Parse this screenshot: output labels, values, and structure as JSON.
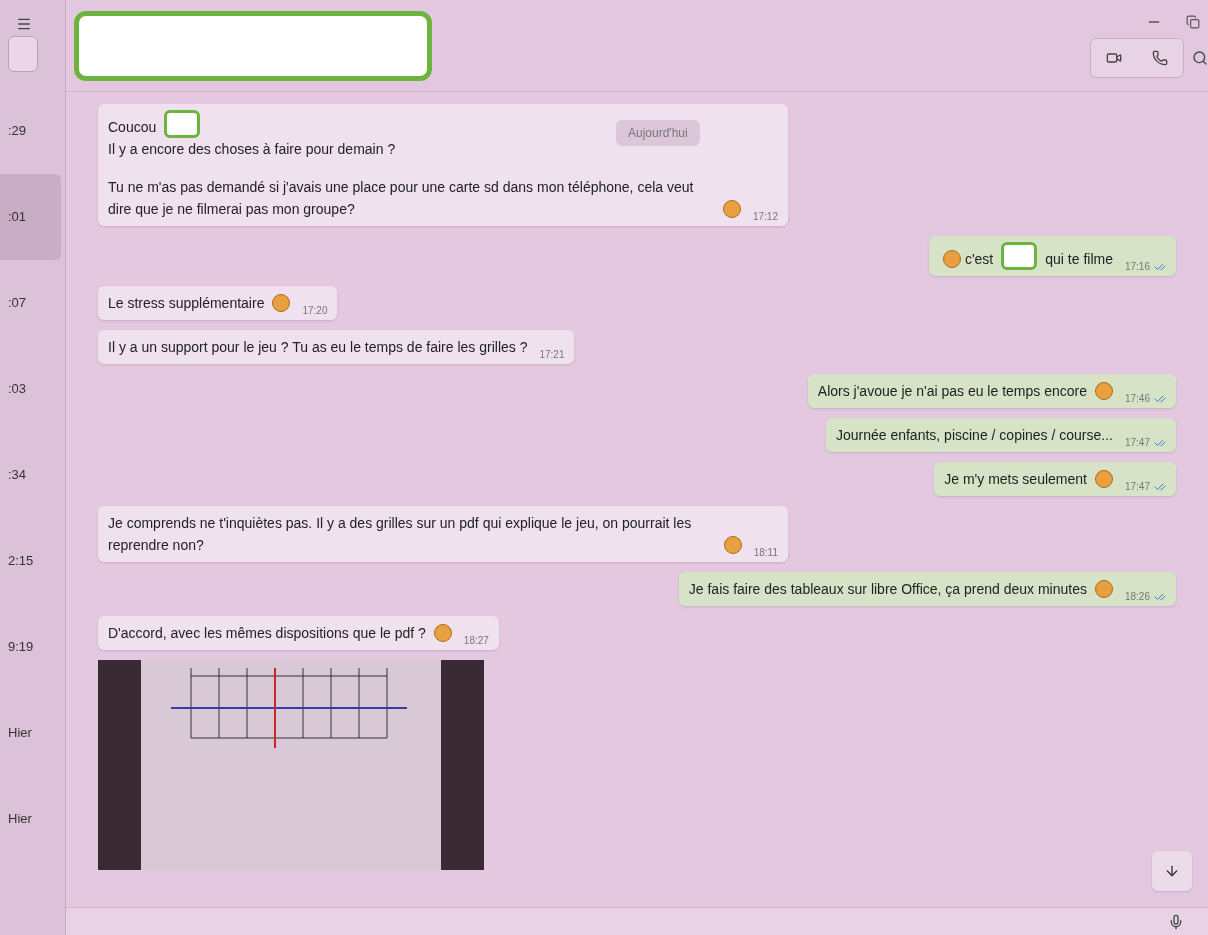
{
  "sidebar": {
    "items": [
      {
        "time": ":29",
        "selected": false
      },
      {
        "time": ":01",
        "selected": true
      },
      {
        "time": ":07",
        "selected": false
      },
      {
        "time": ":03",
        "selected": false
      },
      {
        "time": ":34",
        "selected": false
      },
      {
        "time": "2:15",
        "selected": false
      },
      {
        "time": "9:19",
        "selected": false
      },
      {
        "time": "Hier",
        "selected": false
      },
      {
        "time": "Hier",
        "selected": false
      }
    ]
  },
  "chat": {
    "date_chip": "Aujourd'hui",
    "messages": [
      {
        "kind": "incoming",
        "time": "17:12",
        "paragraphs": [
          [
            [
              {
                "kind": "text",
                "text": "Coucou"
              },
              {
                "kind": "redaction"
              }
            ],
            [
              {
                "kind": "text",
                "text": "Il y a encore des choses à faire pour demain ?"
              }
            ]
          ],
          [
            [
              {
                "kind": "text",
                "text": "Tu ne m'as pas demandé si j'avais une place pour une carte sd dans mon téléphone, cela veut dire que je ne filmerai pas mon groupe?"
              },
              {
                "kind": "emoji"
              }
            ]
          ]
        ]
      },
      {
        "kind": "outgoing",
        "time": "17:16",
        "read": true,
        "paragraphs": [
          [
            [
              {
                "kind": "emoji"
              },
              {
                "kind": "text",
                "text": "c'est"
              },
              {
                "kind": "redaction"
              },
              {
                "kind": "text",
                "text": "qui te filme"
              }
            ]
          ]
        ]
      },
      {
        "kind": "incoming",
        "time": "17:20",
        "paragraphs": [
          [
            [
              {
                "kind": "text",
                "text": "Le stress supplémentaire"
              },
              {
                "kind": "emoji"
              }
            ]
          ]
        ]
      },
      {
        "kind": "incoming",
        "time": "17:21",
        "paragraphs": [
          [
            [
              {
                "kind": "text",
                "text": "Il y a un support pour le jeu ? Tu as eu le temps de faire les grilles ?"
              }
            ]
          ]
        ]
      },
      {
        "kind": "outgoing",
        "time": "17:46",
        "read": true,
        "paragraphs": [
          [
            [
              {
                "kind": "text",
                "text": "Alors j'avoue je n'ai pas eu le temps encore"
              },
              {
                "kind": "emoji"
              }
            ]
          ]
        ]
      },
      {
        "kind": "outgoing",
        "time": "17:47",
        "read": true,
        "paragraphs": [
          [
            [
              {
                "kind": "text",
                "text": "Journée enfants, piscine / copines / course..."
              }
            ]
          ]
        ]
      },
      {
        "kind": "outgoing",
        "time": "17:47",
        "read": true,
        "paragraphs": [
          [
            [
              {
                "kind": "text",
                "text": "Je m'y mets seulement"
              },
              {
                "kind": "emoji"
              }
            ]
          ]
        ]
      },
      {
        "kind": "incoming",
        "time": "18:11",
        "paragraphs": [
          [
            [
              {
                "kind": "text",
                "text": "Je comprends ne t'inquiètes pas. Il y a des grilles sur un pdf qui explique le jeu, on pourrait les reprendre non?"
              },
              {
                "kind": "emoji"
              }
            ]
          ]
        ]
      },
      {
        "kind": "outgoing",
        "time": "18:26",
        "read": true,
        "paragraphs": [
          [
            [
              {
                "kind": "text",
                "text": "Je fais faire des tableaux sur libre Office, ça prend deux minutes"
              },
              {
                "kind": "emoji"
              }
            ]
          ]
        ]
      },
      {
        "kind": "incoming",
        "time": "18:27",
        "paragraphs": [
          [
            [
              {
                "kind": "text",
                "text": "D'accord, avec les mêmes dispositions que le pdf ?"
              },
              {
                "kind": "emoji"
              }
            ]
          ]
        ]
      },
      {
        "kind": "photo"
      }
    ]
  }
}
